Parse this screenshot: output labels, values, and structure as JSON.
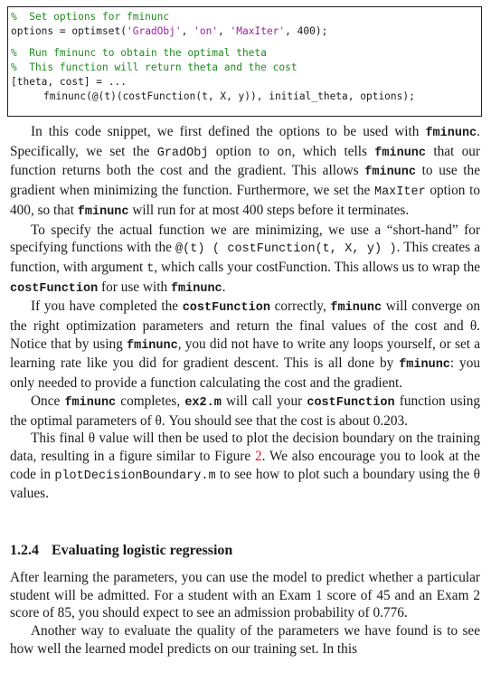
{
  "code": {
    "line1_comment": "%  Set options for fminunc",
    "line2_a": "options = optimset(",
    "line2_s1": "'GradObj'",
    "line2_b": ", ",
    "line2_s2": "'on'",
    "line2_c": ", ",
    "line2_s3": "'MaxIter'",
    "line2_d": ", 400);",
    "line3_comment": "%  Run fminunc to obtain the optimal theta",
    "line4_comment": "%  This function will return theta and the cost",
    "line5": "[theta, cost] = ...",
    "line6": "fminunc(@(t)(costFunction(t, X, y)), initial_theta, options);"
  },
  "p1": {
    "a": "In this code snippet, we first defined the options to be used with ",
    "fminunc1": "fminunc",
    "b": ". Specifically, we set the ",
    "gradobj": "GradObj",
    "c": " option to ",
    "on": "on",
    "d": ", which tells ",
    "fminunc2": "fminunc",
    "e": " that our function returns both the cost and the gradient. This allows ",
    "fminunc3": "fminunc",
    "f": " to use the gradient when minimizing the function. Furthermore, we set the ",
    "maxiter": "MaxIter",
    "g": " option to 400, so that ",
    "fminunc4": "fminunc",
    "h": " will run for at most 400 steps before it terminates."
  },
  "p2": {
    "a": "To specify the actual function we are minimizing, we use a “short-hand” for specifying functions with the ",
    "code": "@(t) ( costFunction(t, X, y) )",
    "b": ". This creates a function, with argument ",
    "t": "t",
    "c": ", which calls your costFunction. This allows us to wrap the ",
    "costfn": "costFunction",
    "d": " for use with ",
    "fminunc": "fminunc",
    "e": "."
  },
  "p3": {
    "a": "If you have completed the ",
    "costfn": "costFunction",
    "b": " correctly, ",
    "fminunc1": "fminunc",
    "c": " will converge on the right optimization parameters and return the final values of the cost and θ. Notice that by using ",
    "fminunc2": "fminunc",
    "d": ", you did not have to write any loops yourself, or set a learning rate like you did for gradient descent. This is all done by ",
    "fminunc3": "fminunc",
    "e": ": you only needed to provide a function calculating the cost and the gradient."
  },
  "p4": {
    "a": "Once ",
    "fminunc": "fminunc",
    "b": " completes, ",
    "ex2": "ex2.m",
    "c": " will call your ",
    "costfn": "costFunction",
    "d": " function using the optimal parameters of θ. You should see that the cost is about 0.203."
  },
  "p5": {
    "a": "This final θ value will then be used to plot the decision boundary on the training data, resulting in a figure similar to Figure ",
    "figref": "2",
    "b": ". We also encourage you to look at the code in ",
    "plotdb": "plotDecisionBoundary.m",
    "c": " to see how to plot such a boundary using the θ values."
  },
  "section": {
    "number": "1.2.4",
    "title": "Evaluating logistic regression"
  },
  "p6": {
    "text": "After learning the parameters, you can use the model to predict whether a particular student will be admitted. For a student with an Exam 1 score of 45 and an Exam 2 score of 85, you should expect to see an admission probability of 0.776."
  },
  "p7": {
    "text": "Another way to evaluate the quality of the parameters we have found is to see how well the learned model predicts on our training set. In this"
  }
}
